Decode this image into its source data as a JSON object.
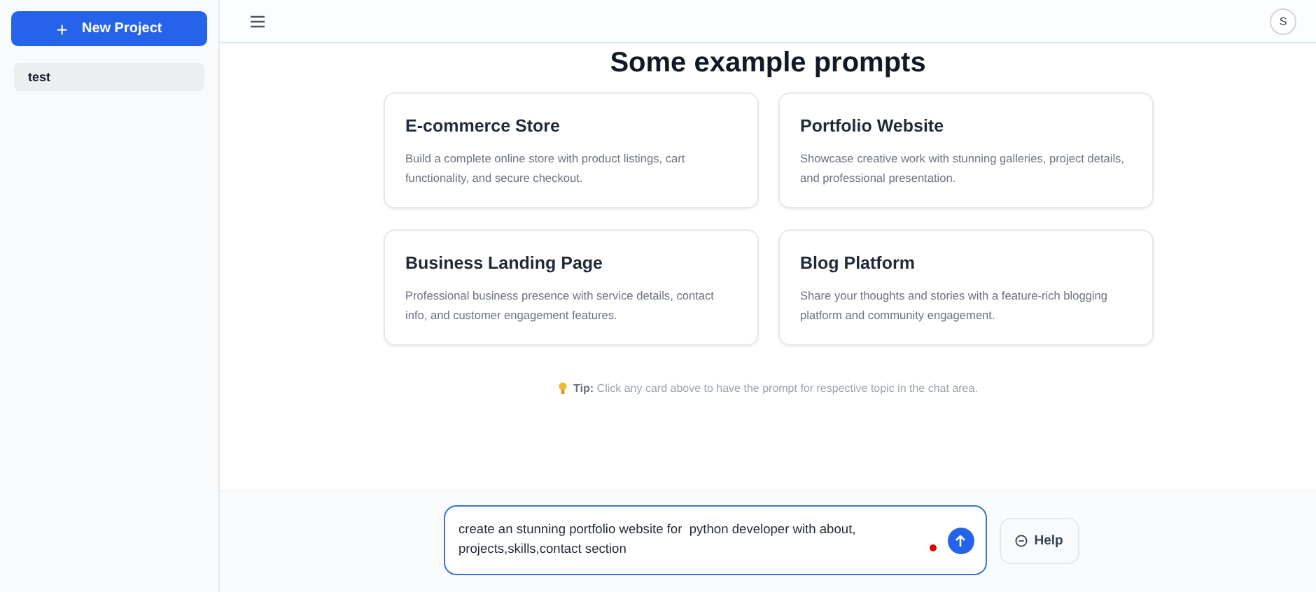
{
  "sidebar": {
    "new_button": {
      "icon": "+",
      "label": "New Project"
    },
    "projects": [
      {
        "name": "test",
        "selected": true
      }
    ]
  },
  "header": {
    "avatar": "S"
  },
  "heading": "Some example prompts",
  "cards": [
    {
      "title": "E-commerce Store",
      "description": "Build a complete online store with product listings, cart functionality, and secure checkout."
    },
    {
      "title": "Portfolio Website",
      "description": "Showcase creative work with stunning galleries, project details, and professional presentation."
    },
    {
      "title": "Business Landing Page",
      "description": "Professional business presence with service details, contact info, and customer engagement features."
    },
    {
      "title": "Blog Platform",
      "description": "Share your thoughts and stories with a feature-rich blogging platform and community engagement."
    }
  ],
  "tip": "**Tip:** Click any card above to have the prompt for respective topic in the chat area.",
  "chat": {
    "value": "create an stunning portfolio website for  python developer with about, projects,skills,contact section",
    "help_label": "Help"
  }
}
